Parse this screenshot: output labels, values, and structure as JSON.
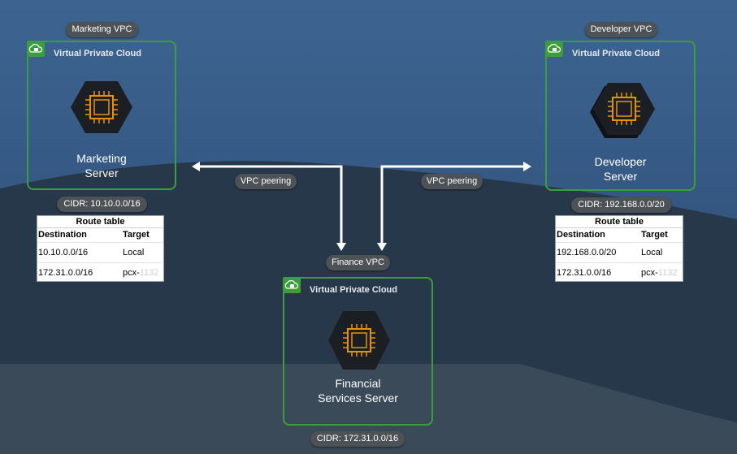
{
  "colors": {
    "vpc_border": "#3c9d3c",
    "pill_bg": "#4d5257",
    "arrow": "#ffffff",
    "chip": "#e8920c"
  },
  "marketing": {
    "vpc_label": "Marketing VPC",
    "vpc_title": "Virtual Private Cloud",
    "server_line1": "Marketing",
    "server_line2": "Server",
    "cidr": "CIDR: 10.10.0.0/16",
    "route_table": {
      "title": "Route table",
      "headers": [
        "Destination",
        "Target"
      ],
      "rows": [
        [
          "10.10.0.0/16",
          "Local"
        ],
        [
          "172.31.0.0/16",
          "pcx-",
          "1132"
        ]
      ]
    }
  },
  "developer": {
    "vpc_label": "Developer VPC",
    "vpc_title": "Virtual Private Cloud",
    "server_line1": "Developer",
    "server_line2": "Server",
    "cidr": "CIDR: 192.168.0.0/20",
    "route_table": {
      "title": "Route table",
      "headers": [
        "Destination",
        "Target"
      ],
      "rows": [
        [
          "192.168.0.0/20",
          "Local"
        ],
        [
          "172.31.0.0/16",
          "pcx-",
          "1132"
        ]
      ]
    }
  },
  "finance": {
    "vpc_label": "Finance VPC",
    "vpc_title": "Virtual Private Cloud",
    "server_line1": "Financial",
    "server_line2": "Services Server",
    "cidr": "CIDR: 172.31.0.0/16"
  },
  "peering": {
    "left_label": "VPC peering",
    "right_label": "VPC peering"
  },
  "icons": {
    "vpc": "cloud-lock-icon",
    "server": "ec2-instance-icon"
  }
}
